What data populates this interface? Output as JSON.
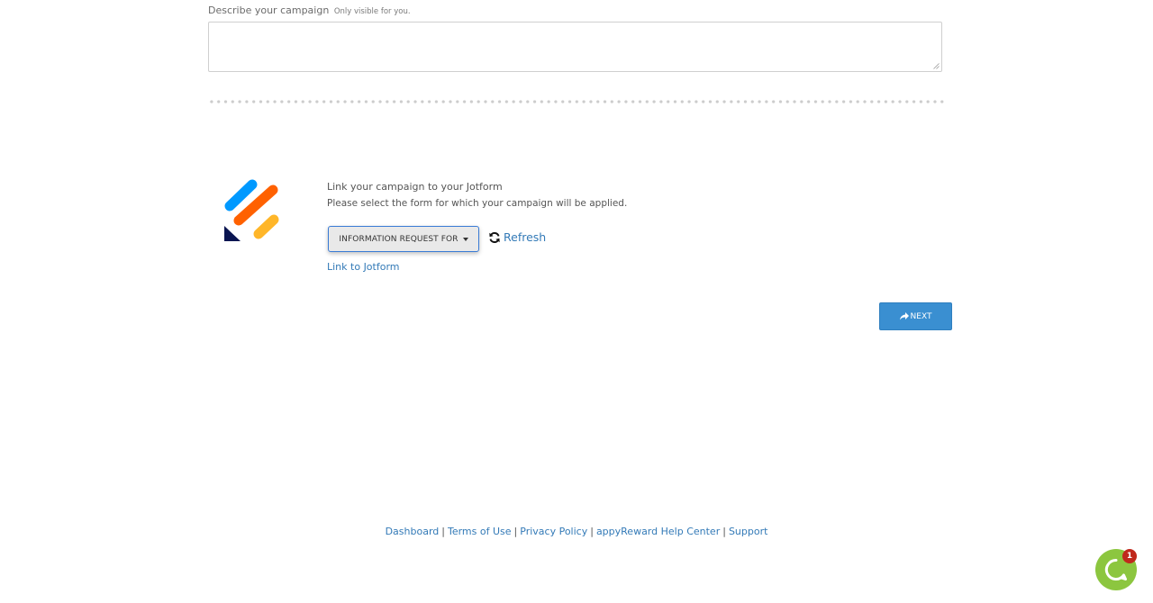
{
  "describe": {
    "label": "Describe your campaign",
    "hint": "Only visible for you.",
    "value": ""
  },
  "jotform": {
    "title": "Link your campaign to your Jotform",
    "subtitle": "Please select the form for which your campaign will be applied.",
    "selected_form": "INFORMATION REQUEST FOR",
    "refresh_label": "Refresh",
    "link_label": "Link to Jotform",
    "logo_colors": [
      "#0099ff",
      "#ff6100",
      "#ffb629",
      "#0a1551"
    ]
  },
  "actions": {
    "next_label": "NEXT"
  },
  "footer": {
    "links": [
      "Dashboard",
      "Terms of Use",
      "Privacy Policy",
      "appyReward Help Center",
      "Support"
    ],
    "separator": "|"
  },
  "chat": {
    "badge_count": "1",
    "color": "#8cc63f"
  },
  "colors": {
    "link": "#337ab7",
    "primary_button": "#3a8fd1",
    "select_border": "#3a7bd5"
  }
}
